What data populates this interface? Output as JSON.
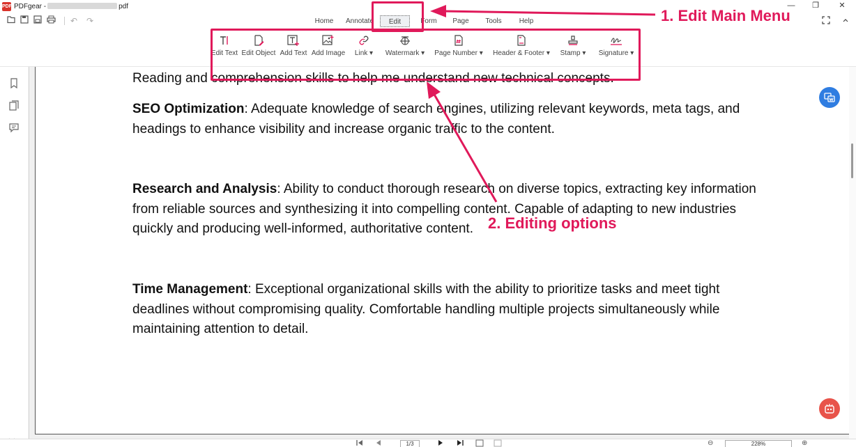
{
  "window": {
    "app_name": "PDFgear -",
    "file_suffix": "pdf",
    "logo_text": "PDF",
    "controls": {
      "minimize": "—",
      "maximize": "❐",
      "close": "✕"
    }
  },
  "quick_access": {
    "open": "open-folder-icon",
    "save": "save-icon",
    "save_as": "save-as-icon",
    "print": "print-icon",
    "undo": "↶",
    "redo": "↷"
  },
  "menu": {
    "items": [
      {
        "label": "Home"
      },
      {
        "label": "Annotate"
      },
      {
        "label": "Edit",
        "active": true
      },
      {
        "label": "Form"
      },
      {
        "label": "Page"
      },
      {
        "label": "Tools"
      },
      {
        "label": "Help"
      }
    ]
  },
  "ribbon": {
    "tools": [
      {
        "label": "Edit Text",
        "icon": "edit-text-icon"
      },
      {
        "label": "Edit Object",
        "icon": "edit-object-icon"
      },
      {
        "label": "Add Text",
        "icon": "add-text-icon"
      },
      {
        "label": "Add Image",
        "icon": "add-image-icon"
      },
      {
        "label": "Link",
        "icon": "link-icon",
        "dropdown": "▾"
      },
      {
        "label": "Watermark",
        "icon": "watermark-icon",
        "dropdown": "▾"
      },
      {
        "label": "Page Number",
        "icon": "page-number-icon",
        "dropdown": "▾"
      },
      {
        "label": "Header & Footer",
        "icon": "header-footer-icon",
        "dropdown": "▾"
      },
      {
        "label": "Stamp",
        "icon": "stamp-icon",
        "dropdown": "▾"
      },
      {
        "label": "Signature",
        "icon": "signature-icon",
        "dropdown": "▾"
      }
    ]
  },
  "document": {
    "paragraphs": [
      {
        "bold": "",
        "text": "Reading and comprehension skills to help me understand new technical concepts."
      },
      {
        "bold": "SEO Optimization",
        "text": ": Adequate knowledge of  search engines, utilizing relevant keywords, meta tags, and headings to enhance visibility and increase organic traffic to the content."
      },
      {
        "bold": "Research and Analysis",
        "text": ": Ability to conduct thorough research on diverse topics, extracting key information from reliable sources and synthesizing it into compelling content. Capable of adapting to new industries quickly and producing well-informed, authoritative content."
      },
      {
        "bold": "Time Management",
        "text": ": Exceptional organizational skills with the ability to prioritize tasks and meet tight deadlines without compromising quality. Comfortable handling multiple projects simultaneously while maintaining attention to detail."
      }
    ]
  },
  "navigation": {
    "page_value": "1/3",
    "zoom_value": "228%",
    "zoom_out": "⊖",
    "zoom_in": "⊕"
  },
  "annotations": {
    "label1": "1. Edit Main Menu",
    "label2": "2. Editing options",
    "color": "#e0195a"
  },
  "colors": {
    "accent_annotation": "#e0195a",
    "translate_button": "#2f7de1",
    "assistant_button": "#e8534a"
  }
}
